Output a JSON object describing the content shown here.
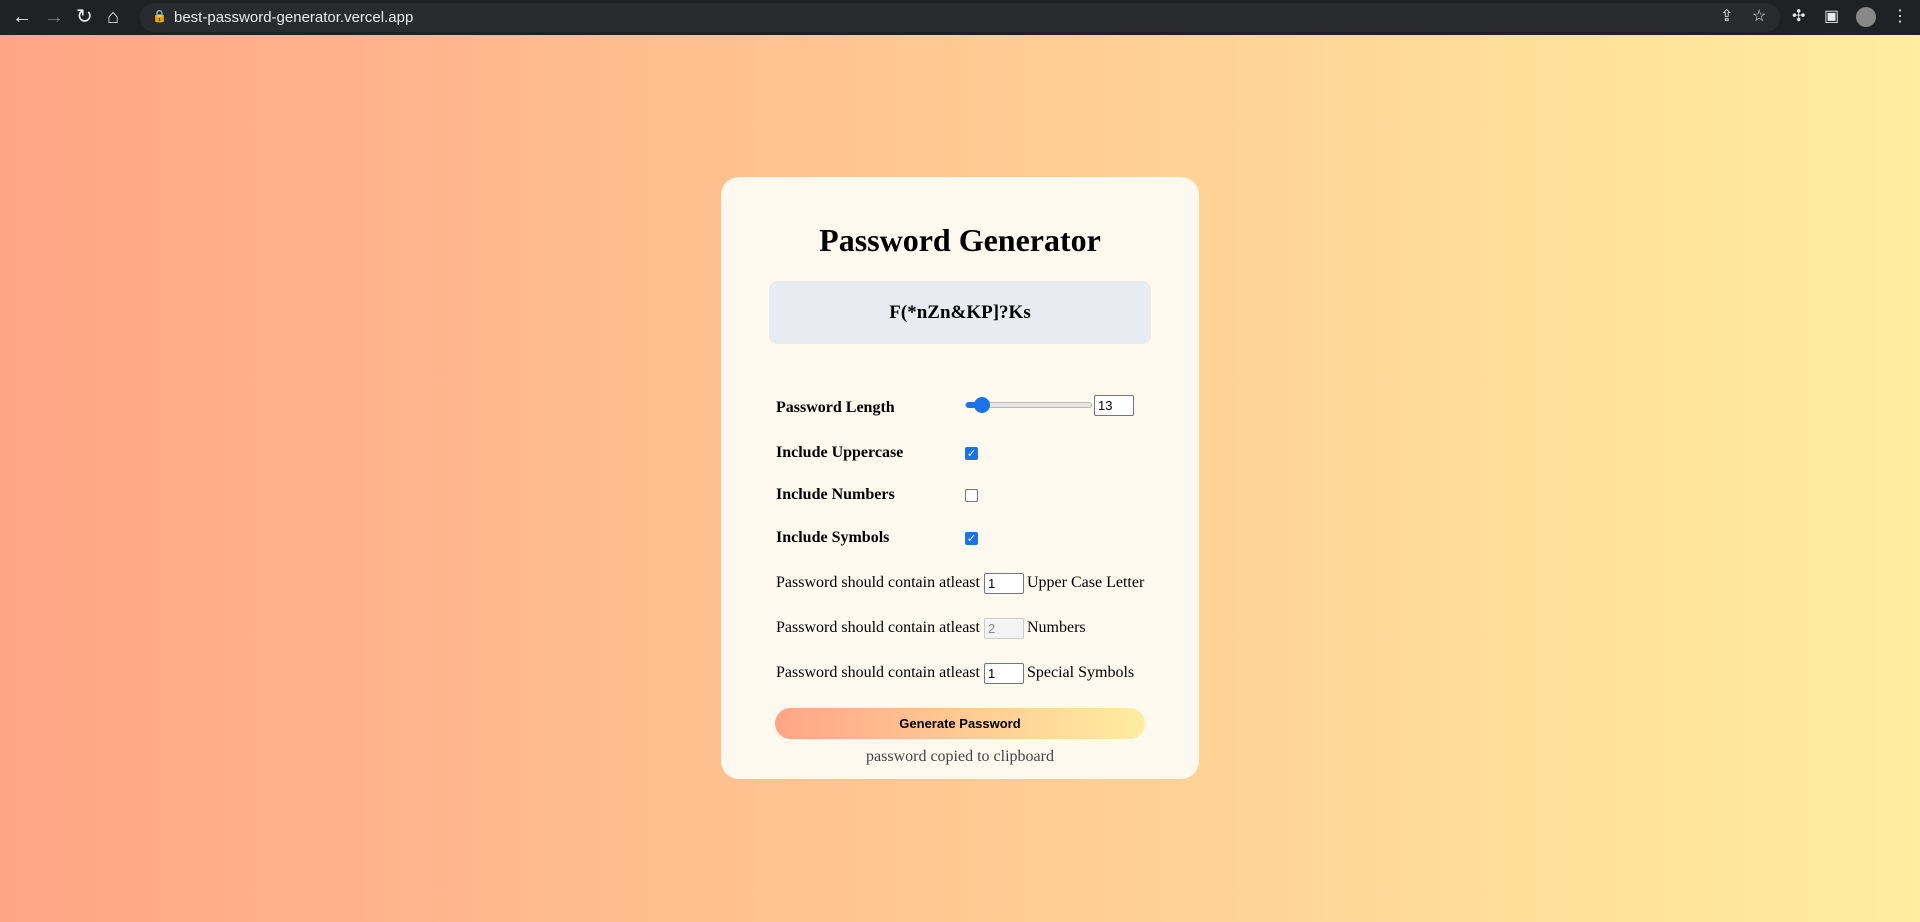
{
  "browser": {
    "url": "best-password-generator.vercel.app"
  },
  "app": {
    "title": "Password Generator",
    "password": "F(*nZn&KP]?Ks",
    "length_label": "Password Length",
    "length_value": "13",
    "uppercase_label": "Include Uppercase",
    "uppercase_checked": true,
    "numbers_label": "Include Numbers",
    "numbers_checked": false,
    "symbols_label": "Include Symbols",
    "symbols_checked": true,
    "min_prefix": "Password should contain atleast",
    "min_upper": "1",
    "min_upper_suffix": "Upper Case Letter",
    "min_numbers": "2",
    "min_numbers_suffix": "Numbers",
    "min_symbols": "1",
    "min_symbols_suffix": "Special Symbols",
    "generate_label": "Generate Password",
    "status": "password copied to clipboard"
  },
  "colors": {
    "gradient_start": "#ffa585",
    "gradient_end": "#ffeda0",
    "accent": "#1a73e8"
  }
}
